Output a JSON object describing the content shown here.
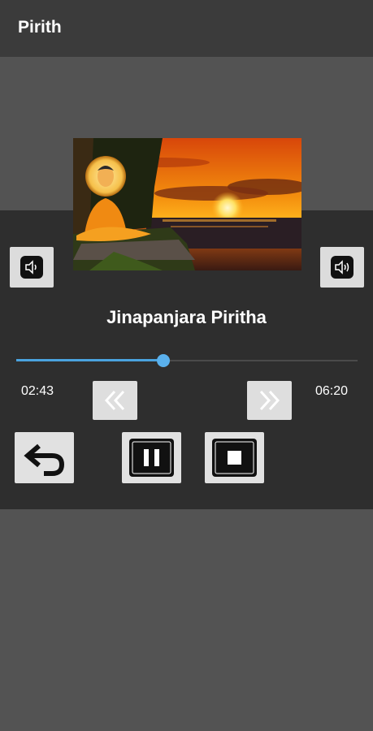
{
  "appbar": {
    "title": "Pirith"
  },
  "track": {
    "title": "Jinapanjara Piritha"
  },
  "progress": {
    "current_time": "02:43",
    "total_time": "06:20",
    "fraction": 0.43
  },
  "icons": {
    "volume_left": "speaker-icon",
    "volume_right": "speaker-icon",
    "rewind": "double-chevron-left-icon",
    "fast_forward": "double-chevron-right-icon",
    "back": "undo-arrow-icon",
    "pause": "pause-icon",
    "stop": "stop-icon"
  },
  "colors": {
    "accent": "#4aa3df",
    "appbar": "#3b3b3b",
    "background": "#535353",
    "panel": "#2e2e2e"
  }
}
